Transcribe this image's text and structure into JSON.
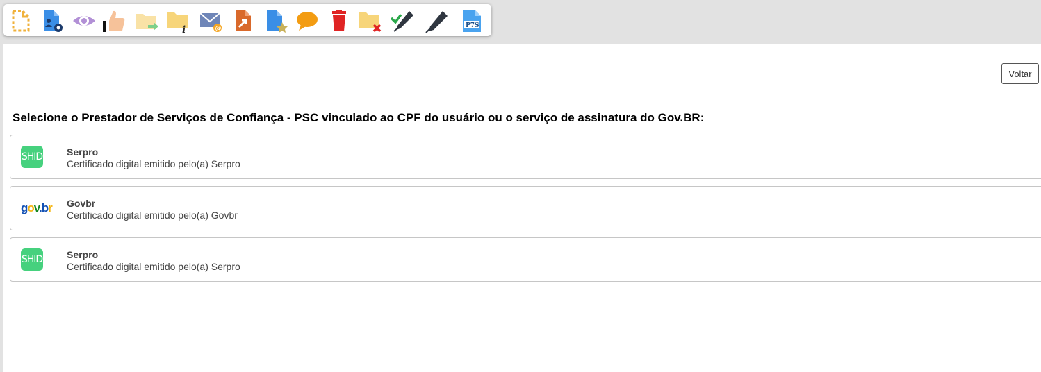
{
  "toolbar": {
    "icons": [
      {
        "name": "new-document-icon"
      },
      {
        "name": "document-settings-icon"
      },
      {
        "name": "view-eye-icon"
      },
      {
        "name": "thumbs-up-icon"
      },
      {
        "name": "move-folder-icon"
      },
      {
        "name": "folder-info-icon"
      },
      {
        "name": "email-icon"
      },
      {
        "name": "export-document-icon"
      },
      {
        "name": "document-favorite-icon"
      },
      {
        "name": "comment-icon"
      },
      {
        "name": "trash-icon"
      },
      {
        "name": "folder-remove-icon"
      },
      {
        "name": "sign-check-pen-icon"
      },
      {
        "name": "sign-pen-icon"
      },
      {
        "name": "p7s-file-icon",
        "label": "P7S"
      }
    ]
  },
  "page": {
    "back_button": {
      "first_letter": "V",
      "rest": "oltar"
    },
    "heading": "Selecione o Prestador de Serviços de Confiança - PSC vinculado ao CPF do usuário ou o serviço de assinatura do Gov.BR:"
  },
  "providers": [
    {
      "logo": "serpro-shid-logo",
      "logo_text": "SHID",
      "title": "Serpro",
      "description": "Certificado digital emitido pelo(a) Serpro"
    },
    {
      "logo": "govbr-logo",
      "logo_text": "gov.br",
      "title": "Govbr",
      "description": "Certificado digital emitido pelo(a) Govbr"
    },
    {
      "logo": "serpro-shid-logo",
      "logo_text": "SHID",
      "title": "Serpro",
      "description": "Certificado digital emitido pelo(a) Serpro"
    }
  ],
  "colors": {
    "serpro_green": "#46d17e",
    "gov_blue": "#1351b4",
    "gov_yellow": "#f5b40d",
    "gov_green": "#168821",
    "trash_red": "#e02424",
    "folder_yellow": "#f7d57a",
    "comment_orange": "#f39c12"
  }
}
